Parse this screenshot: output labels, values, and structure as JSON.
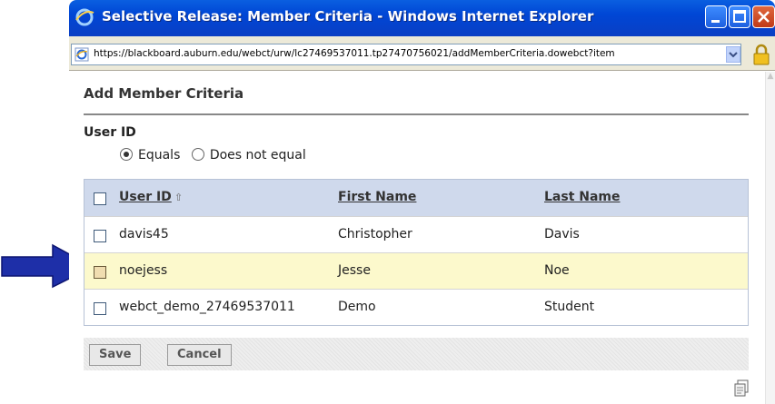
{
  "window": {
    "title": "Selective Release: Member Criteria - Windows Internet Explorer",
    "url": "https://blackboard.auburn.edu/webct/urw/lc27469537011.tp27470756021/addMemberCriteria.dowebct?item"
  },
  "page": {
    "heading": "Add Member Criteria",
    "section_label": "User ID",
    "radios": [
      {
        "label": "Equals",
        "selected": true
      },
      {
        "label": "Does not equal",
        "selected": false
      }
    ]
  },
  "table": {
    "headers": {
      "user_id": "User ID",
      "first_name": "First Name",
      "last_name": "Last Name"
    },
    "rows": [
      {
        "user_id": "davis45",
        "first_name": "Christopher",
        "last_name": "Davis",
        "highlighted": false
      },
      {
        "user_id": "noejess",
        "first_name": "Jesse",
        "last_name": "Noe",
        "highlighted": true
      },
      {
        "user_id": "webct_demo_27469537011",
        "first_name": "Demo",
        "last_name": "Student",
        "highlighted": false
      }
    ]
  },
  "buttons": {
    "save": "Save",
    "cancel": "Cancel"
  },
  "icons": {
    "title": "ie-logo-icon",
    "address": "ie-page-icon",
    "lock": "lock-icon",
    "page_action": "copy-page-icon",
    "annotation": "blue-arrow-icon",
    "sort": "sort-ascending-icon"
  },
  "colors": {
    "titlebar": "#0046d5",
    "table_header": "#cfd9ec",
    "row_highlight": "#fcf9cc",
    "arrow": "#1e2fa8"
  }
}
